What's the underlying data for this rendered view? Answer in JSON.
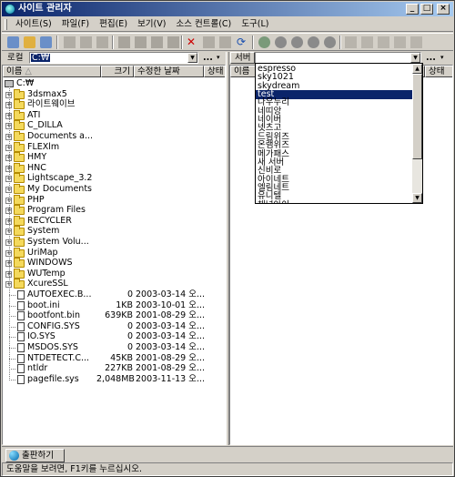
{
  "window": {
    "title": "사이트 관리자"
  },
  "menu": [
    "사이트(S)",
    "파일(F)",
    "편집(E)",
    "보기(V)",
    "소스 컨트롤(C)",
    "도구(L)"
  ],
  "left": {
    "path_label": "로컬",
    "path_value": "C:₩",
    "columns": [
      "이름",
      "크기",
      "수정한 날짜",
      "상태"
    ],
    "root": "C:₩",
    "folders": [
      "3dsmax5",
      "라이트웨이브",
      "ATI",
      "C_DILLA",
      "Documents a...",
      "FLEXlm",
      "HMY",
      "HNC",
      "Lightscape_3.2",
      "My Documents",
      "PHP",
      "Program Files",
      "RECYCLER",
      "System",
      "System Volu...",
      "UriMap",
      "WINDOWS",
      "WUTemp",
      "XcureSSL"
    ],
    "files": [
      {
        "name": "AUTOEXEC.B...",
        "size": "0",
        "date": "2003-03-14 오..."
      },
      {
        "name": "boot.ini",
        "size": "1KB",
        "date": "2003-10-01 오..."
      },
      {
        "name": "bootfont.bin",
        "size": "639KB",
        "date": "2001-08-29 오..."
      },
      {
        "name": "CONFIG.SYS",
        "size": "0",
        "date": "2003-03-14 오..."
      },
      {
        "name": "IO.SYS",
        "size": "0",
        "date": "2003-03-14 오..."
      },
      {
        "name": "MSDOS.SYS",
        "size": "0",
        "date": "2003-03-14 오..."
      },
      {
        "name": "NTDETECT.C...",
        "size": "45KB",
        "date": "2001-08-29 오..."
      },
      {
        "name": "ntldr",
        "size": "227KB",
        "date": "2001-08-29 오..."
      },
      {
        "name": "pagefile.sys",
        "size": "2,048MB",
        "date": "2003-11-13 오..."
      }
    ]
  },
  "right": {
    "path_label": "서버",
    "columns": [
      "이름",
      "상태"
    ],
    "dropdown_items": [
      "espresso",
      "sky1021",
      "skydream",
      "test",
      "나우누리",
      "네띠앙",
      "네이버",
      "넷츠고",
      "드림위즈",
      "온램위즈",
      "메가패스",
      "새 서버",
      "신비로",
      "아이네트",
      "엘림네트",
      "유니텔",
      "채널아이"
    ],
    "selected_item": "test"
  },
  "bottom_tab": "출판하기",
  "status": "도움말을 보려면, F1키를 누르십시오.",
  "toolbar_icons": [
    "connect-icon",
    "disconnect-icon",
    "refresh-icon",
    "cut-icon",
    "copy-icon",
    "paste-icon",
    "open-icon",
    "folder-icon",
    "new-folder-icon",
    "delete-icon",
    "rename-icon",
    "properties-icon",
    "sync-icon",
    "upload-icon",
    "download-icon",
    "check-in-icon",
    "check-out-icon",
    "view-icon"
  ],
  "colors": {
    "selection": "#0a246a",
    "title_start": "#0a246a",
    "title_end": "#a6caf0",
    "chrome": "#d4d0c8"
  }
}
